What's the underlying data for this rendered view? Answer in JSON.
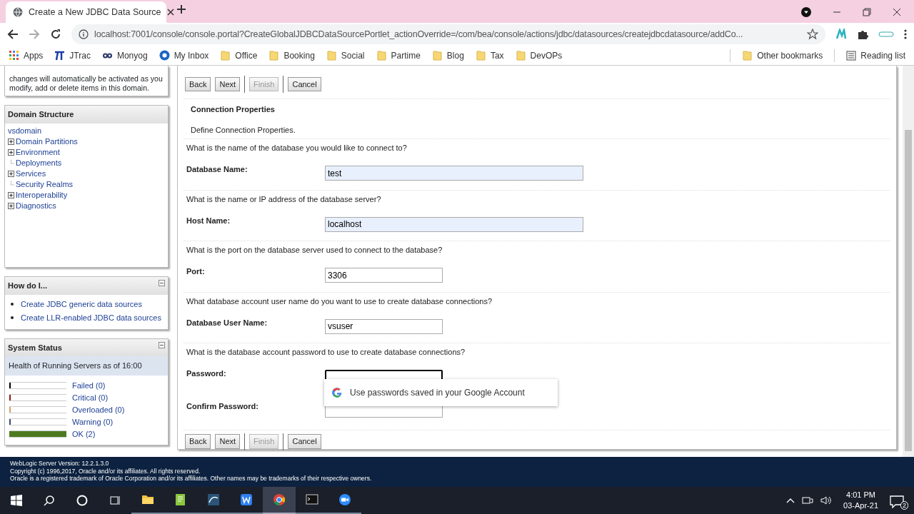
{
  "browser": {
    "tab_title": "Create a New JDBC Data Source",
    "url": "localhost:7001/console/console.portal?CreateGlobalJDBCDataSourcePortlet_actionOverride=/com/bea/console/actions/jdbc/datasources/createjdbcdatasource/addCo...",
    "bookmarks": [
      {
        "label": "Apps",
        "kind": "apps"
      },
      {
        "label": "JTrac",
        "kind": "jtrac"
      },
      {
        "label": "Monyog",
        "kind": "monyog"
      },
      {
        "label": "My Inbox",
        "kind": "inbox"
      },
      {
        "label": "Office",
        "kind": "folder"
      },
      {
        "label": "Booking",
        "kind": "folder"
      },
      {
        "label": "Social",
        "kind": "folder"
      },
      {
        "label": "Partime",
        "kind": "folder"
      },
      {
        "label": "Blog",
        "kind": "folder"
      },
      {
        "label": "Tax",
        "kind": "folder"
      },
      {
        "label": "DevOPs",
        "kind": "folder"
      }
    ],
    "other_bookmarks": "Other bookmarks",
    "reading_list": "Reading list"
  },
  "change_center": {
    "text": "changes will automatically be activated as you modify, add or delete items in this domain."
  },
  "domain_structure": {
    "title": "Domain Structure",
    "root": "vsdomain",
    "children": [
      {
        "label": "Domain Partitions",
        "expandable": true
      },
      {
        "label": "Environment",
        "expandable": true
      },
      {
        "label": "Deployments",
        "expandable": false
      },
      {
        "label": "Services",
        "expandable": true
      },
      {
        "label": "Security Realms",
        "expandable": false
      },
      {
        "label": "Interoperability",
        "expandable": true
      },
      {
        "label": "Diagnostics",
        "expandable": true
      }
    ]
  },
  "how_do_i": {
    "title": "How do I...",
    "links": [
      "Create JDBC generic data sources",
      "Create LLR-enabled JDBC data sources"
    ]
  },
  "system_status": {
    "title": "System Status",
    "heading": "Health of Running Servers as of  16:00",
    "rows": [
      {
        "label": "Failed (0)",
        "level": 0,
        "color": "#000000"
      },
      {
        "label": "Critical (0)",
        "level": 0,
        "color": "#8b1a1a"
      },
      {
        "label": "Overloaded (0)",
        "level": 0,
        "color": "#d9a066"
      },
      {
        "label": "Warning (0)",
        "level": 0,
        "color": "#3a4a7a"
      },
      {
        "label": "OK (2)",
        "level": 1,
        "color": "#4d7a1f"
      }
    ]
  },
  "wizard": {
    "buttons": [
      {
        "label": "Back",
        "disabled": false
      },
      {
        "label": "Next",
        "disabled": false
      },
      {
        "label": "Finish",
        "disabled": true
      },
      {
        "label": "Cancel",
        "disabled": false
      }
    ],
    "section_title": "Connection Properties",
    "section_text": "Define Connection Properties.",
    "fields": [
      {
        "question": "What is the name of the database you would like to connect to?",
        "label": "Database Name:",
        "value": "test",
        "kind": "long",
        "focused": false
      },
      {
        "question": "What is the name or IP address of the database server?",
        "label": "Host Name:",
        "value": "localhost",
        "kind": "long",
        "focused": false
      },
      {
        "question": "What is the port on the database server used to connect to the database?",
        "label": "Port:",
        "value": "3306",
        "kind": "short",
        "focused": false
      },
      {
        "question": "What database account user name do you want to use to create database connections?",
        "label": "Database User Name:",
        "value": "vsuser",
        "kind": "short",
        "focused": false
      },
      {
        "question": "What is the database account password to use to create database connections?",
        "label": "Password:",
        "kind": "short",
        "focused": true
      },
      {
        "label": "Confirm Password:",
        "kind": "short",
        "focused": false
      }
    ],
    "autofill": "Use passwords saved in your Google Account",
    "bottom_buttons": [
      {
        "label": "Back",
        "disabled": false
      },
      {
        "label": "Next",
        "disabled": false
      },
      {
        "label": "Finish",
        "disabled": true
      },
      {
        "label": "Cancel",
        "disabled": false
      }
    ]
  },
  "footer": [
    "WebLogic Server Version: 12.2.1.3.0",
    "Copyright (c) 1996,2017, Oracle and/or its affiliates. All rights reserved.",
    "Oracle is a registered trademark of Oracle Corporation and/or its affiliates. Other names may be trademarks of their respective owners."
  ],
  "taskbar": {
    "apps": [
      {
        "kind": "explorer",
        "selected": false
      },
      {
        "kind": "notepad",
        "selected": false
      },
      {
        "kind": "workbench",
        "selected": false
      },
      {
        "kind": "writer",
        "selected": false
      },
      {
        "kind": "chrome",
        "selected": true
      },
      {
        "kind": "terminal",
        "selected": false
      },
      {
        "kind": "zoom",
        "selected": false
      }
    ],
    "time": "4:01 PM",
    "date": "03-Apr-21",
    "notifications": "2"
  }
}
